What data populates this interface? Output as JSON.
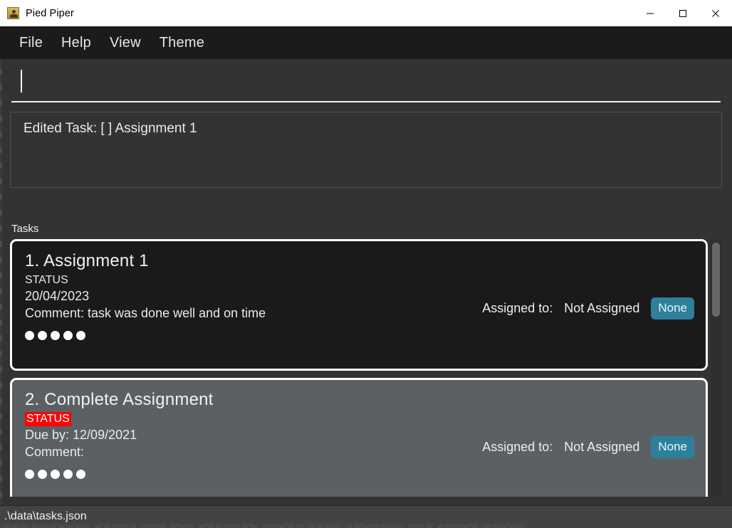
{
  "window": {
    "title": "Pied Piper",
    "icon": "app-person-icon",
    "controls": [
      {
        "name": "minimize",
        "glyph": "minimize-icon"
      },
      {
        "name": "maximize",
        "glyph": "maximize-icon"
      },
      {
        "name": "close",
        "glyph": "close-icon"
      }
    ]
  },
  "menubar": {
    "items": [
      {
        "label": "File"
      },
      {
        "label": "Help"
      },
      {
        "label": "View"
      },
      {
        "label": "Theme"
      }
    ]
  },
  "entry": {
    "value": "",
    "placeholder": ""
  },
  "message_panel": {
    "text": "Edited Task: [ ] Assignment 1"
  },
  "tasks_section": {
    "label": "Tasks",
    "tasks": [
      {
        "title": "1. Assignment 1",
        "status": "STATUS",
        "status_flagged": false,
        "date": "20/04/2023",
        "comment": "Comment: task was done well and on time",
        "assigned_label": "Assigned to:",
        "assigned_value": "Not Assigned",
        "assign_button": "None",
        "dots": 5,
        "selected": true
      },
      {
        "title": "2. Complete Assignment",
        "status": "STATUS",
        "status_flagged": true,
        "date": "Due by: 12/09/2021",
        "comment": "Comment:",
        "assigned_label": "Assigned to:",
        "assigned_value": "Not Assigned",
        "assign_button": "None",
        "dots": 5,
        "selected": false
      }
    ]
  },
  "statusbar": {
    "path": ".\\data\\tasks.json",
    "ghost_line": "WWW WWWWWWW WWWWW WWW WWW WWWWWWW WWWWW WWWW WWWWWWW WWW WWWWW WWWWW"
  },
  "colors": {
    "accent_button": "#2e7f9b",
    "status_flag": "#fb0505",
    "window_chrome": "#ffffff",
    "menu_bg": "#1b1b1b",
    "body_bg": "#333333",
    "card_selected_bg": "#1a1a1a",
    "card_bg": "#5b6064"
  }
}
